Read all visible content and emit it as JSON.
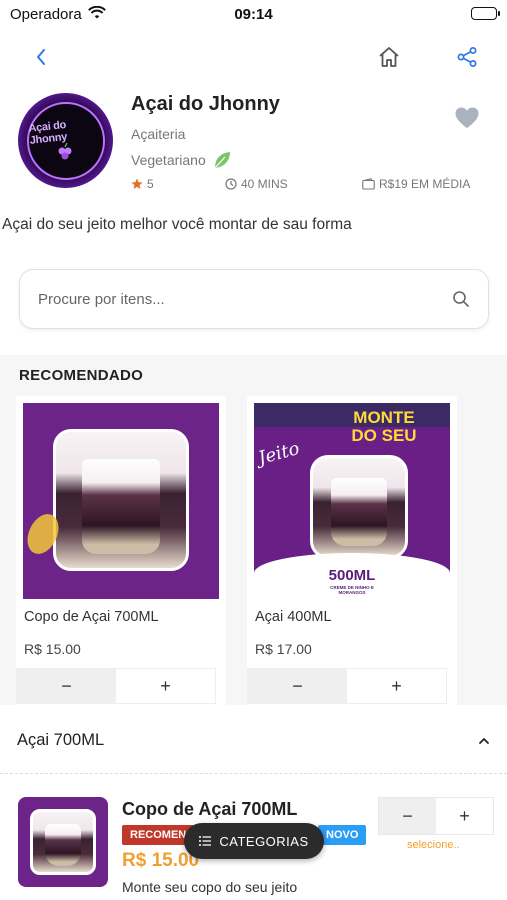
{
  "status_bar": {
    "carrier": "Operadora",
    "time": "09:14"
  },
  "store": {
    "name": "Açai do Jhonny",
    "logo_text": "Açai do Jhonny",
    "category": "Açaiteria",
    "tag": "Vegetariano",
    "rating": "5",
    "delivery_time": "40 MINS",
    "average_price": "R$19 EM MÉDIA",
    "description": "Açai do seu jeito melhor você montar de sau forma"
  },
  "search": {
    "placeholder": "Procure por itens..."
  },
  "recommended": {
    "title": "RECOMENDADO",
    "items": [
      {
        "name": "Copo de Açai 700ML",
        "price": "R$ 15.00"
      },
      {
        "name": "Açai 400ML",
        "price": "R$ 17.00",
        "poster_line1": "MONTE",
        "poster_line2": "DO SEU",
        "poster_script": "Jeito",
        "poster_size": "500ML",
        "poster_sub": "CREME DE NINHO E MORANGOS"
      }
    ]
  },
  "category_section": {
    "title": "Açai 700ML",
    "item": {
      "name": "Copo de Açai 700ML",
      "badge_recommended": "RECOMEN",
      "badge_new": "NOVO",
      "price": "R$ 15.00",
      "description": "Monte seu copo do seu jeito",
      "select_hint": "selecione.."
    }
  },
  "stepper": {
    "minus": "−",
    "plus": "+"
  },
  "categories_button": {
    "label": "CATEGORIAS"
  },
  "colors": {
    "accent": "#2a7be4",
    "purple": "#6d2488",
    "price_orange": "#f0a030",
    "badge_red": "#c0382b",
    "badge_blue": "#2a9df4"
  }
}
